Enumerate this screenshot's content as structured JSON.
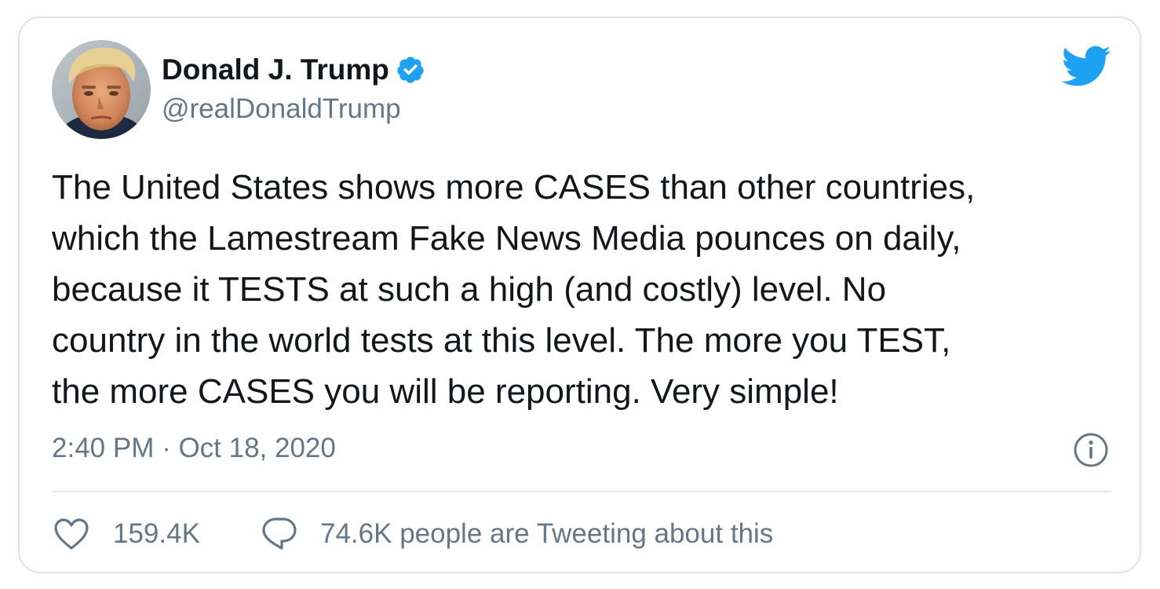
{
  "tweet": {
    "author": {
      "display_name": "Donald J. Trump",
      "handle": "@realDonaldTrump",
      "verified": true,
      "avatar_icon": "profile-photo"
    },
    "text_lines": [
      "The United States shows more CASES than other countries,",
      "which the Lamestream Fake News Media pounces on daily,",
      "because it TESTS at such a high (and costly) level. No",
      "country in the world tests at this level. The more you TEST,",
      "the more CASES you will be reporting. Very simple!"
    ],
    "timestamp": "2:40 PM · Oct 18, 2020",
    "likes": "159.4K",
    "tweeting_about": "74.6K people are Tweeting about this"
  },
  "icons": {
    "brand": "twitter-bird-icon",
    "verified": "verified-badge-icon",
    "info": "info-icon",
    "like": "heart-icon",
    "reply": "speech-bubble-icon"
  },
  "colors": {
    "brand_blue": "#1da1f2",
    "text": "#14171a",
    "secondary_text": "#657786",
    "border": "#dfe3e6"
  }
}
